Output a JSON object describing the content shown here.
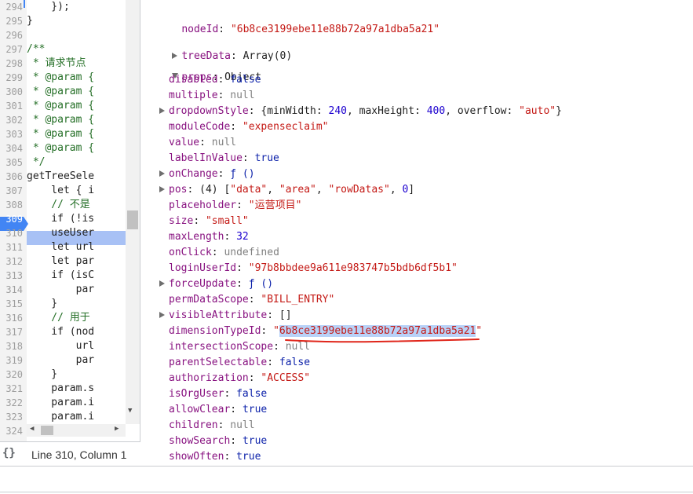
{
  "source": {
    "lines": [
      {
        "num": "294",
        "code": "    });",
        "comment": false
      },
      {
        "num": "295",
        "code": "}",
        "comment": false
      },
      {
        "num": "296",
        "code": "",
        "comment": false
      },
      {
        "num": "297",
        "code": "/**",
        "comment": true
      },
      {
        "num": "298",
        "code": " * 请求节点",
        "comment": true
      },
      {
        "num": "299",
        "code": " * @param {",
        "comment": true
      },
      {
        "num": "300",
        "code": " * @param {",
        "comment": true
      },
      {
        "num": "301",
        "code": " * @param {",
        "comment": true
      },
      {
        "num": "302",
        "code": " * @param {",
        "comment": true
      },
      {
        "num": "303",
        "code": " * @param {",
        "comment": true
      },
      {
        "num": "304",
        "code": " * @param {",
        "comment": true
      },
      {
        "num": "305",
        "code": " */",
        "comment": true
      },
      {
        "num": "306",
        "code": "getTreeSele",
        "comment": false
      },
      {
        "num": "307",
        "code": "    let { i",
        "comment": false
      },
      {
        "num": "308",
        "code": "    // 不是",
        "comment": true
      },
      {
        "num": "309",
        "code": "    if (!is",
        "comment": false
      },
      {
        "num": "310",
        "code": "    useUser",
        "comment": false
      },
      {
        "num": "311",
        "code": "    let url",
        "comment": false
      },
      {
        "num": "312",
        "code": "    let par",
        "comment": false
      },
      {
        "num": "313",
        "code": "    if (isC",
        "comment": false
      },
      {
        "num": "314",
        "code": "        par",
        "comment": false
      },
      {
        "num": "315",
        "code": "    }",
        "comment": false
      },
      {
        "num": "316",
        "code": "    // 用于",
        "comment": true
      },
      {
        "num": "317",
        "code": "    if (nod",
        "comment": false
      },
      {
        "num": "318",
        "code": "        url",
        "comment": false
      },
      {
        "num": "319",
        "code": "        par",
        "comment": false
      },
      {
        "num": "320",
        "code": "    }",
        "comment": false
      },
      {
        "num": "321",
        "code": "    param.s",
        "comment": false
      },
      {
        "num": "322",
        "code": "    param.i",
        "comment": false
      },
      {
        "num": "323",
        "code": "    param.i",
        "comment": false
      },
      {
        "num": "324",
        "code": "",
        "comment": false
      }
    ],
    "breakpoint_line": "309",
    "current_line": "310"
  },
  "status": {
    "pretty_print_icon": "{}",
    "cursor_position": "Line 310, Column 1"
  },
  "scope": {
    "node_id": {
      "key": "nodeId",
      "value": "\"6b8ce3199ebe11e88b72a97a1dba5a21\""
    },
    "tree_data": {
      "key": "treeData",
      "value": "Array(0)"
    },
    "props": {
      "key": "props",
      "value": "Object"
    },
    "props_entries": [
      {
        "key": "disabled",
        "parts": [
          {
            "t": "false",
            "c": "kw"
          }
        ],
        "expandable": false
      },
      {
        "key": "multiple",
        "parts": [
          {
            "t": "null",
            "c": "nul"
          }
        ],
        "expandable": false
      },
      {
        "key": "dropdownStyle",
        "parts": [
          {
            "t": "{minWidth: ",
            "c": "plain"
          },
          {
            "t": "240",
            "c": "num"
          },
          {
            "t": ", maxHeight: ",
            "c": "plain"
          },
          {
            "t": "400",
            "c": "num"
          },
          {
            "t": ", overflow: ",
            "c": "plain"
          },
          {
            "t": "\"auto\"",
            "c": "str"
          },
          {
            "t": "}",
            "c": "plain"
          }
        ],
        "expandable": true
      },
      {
        "key": "moduleCode",
        "parts": [
          {
            "t": "\"expenseclaim\"",
            "c": "str"
          }
        ],
        "expandable": false
      },
      {
        "key": "value",
        "parts": [
          {
            "t": "null",
            "c": "nul"
          }
        ],
        "expandable": false
      },
      {
        "key": "labelInValue",
        "parts": [
          {
            "t": "true",
            "c": "kw"
          }
        ],
        "expandable": false
      },
      {
        "key": "onChange",
        "parts": [
          {
            "t": "ƒ ()",
            "c": "kw"
          }
        ],
        "expandable": true
      },
      {
        "key": "pos",
        "parts": [
          {
            "t": "(4) [",
            "c": "plain"
          },
          {
            "t": "\"data\"",
            "c": "str"
          },
          {
            "t": ", ",
            "c": "plain"
          },
          {
            "t": "\"area\"",
            "c": "str"
          },
          {
            "t": ", ",
            "c": "plain"
          },
          {
            "t": "\"rowDatas\"",
            "c": "str"
          },
          {
            "t": ", ",
            "c": "plain"
          },
          {
            "t": "0",
            "c": "num"
          },
          {
            "t": "]",
            "c": "plain"
          }
        ],
        "expandable": true
      },
      {
        "key": "placeholder",
        "parts": [
          {
            "t": "\"运营项目\"",
            "c": "str"
          }
        ],
        "expandable": false
      },
      {
        "key": "size",
        "parts": [
          {
            "t": "\"small\"",
            "c": "str"
          }
        ],
        "expandable": false
      },
      {
        "key": "maxLength",
        "parts": [
          {
            "t": "32",
            "c": "num"
          }
        ],
        "expandable": false
      },
      {
        "key": "onClick",
        "parts": [
          {
            "t": "undefined",
            "c": "nul"
          }
        ],
        "expandable": false
      },
      {
        "key": "loginUserId",
        "parts": [
          {
            "t": "\"97b8bbdee9a611e983747b5bdb6df5b1\"",
            "c": "str"
          }
        ],
        "expandable": false
      },
      {
        "key": "forceUpdate",
        "parts": [
          {
            "t": "ƒ ()",
            "c": "kw"
          }
        ],
        "expandable": true
      },
      {
        "key": "permDataScope",
        "parts": [
          {
            "t": "\"BILL_ENTRY\"",
            "c": "str"
          }
        ],
        "expandable": false
      },
      {
        "key": "visibleAttribute",
        "parts": [
          {
            "t": "[]",
            "c": "plain"
          }
        ],
        "expandable": true
      },
      {
        "key": "dimensionTypeId",
        "parts": [
          {
            "t": "\"",
            "c": "str"
          },
          {
            "t": "6b8ce3199ebe11e88b72a97a1dba5a21",
            "c": "str sel"
          },
          {
            "t": "\"",
            "c": "str"
          }
        ],
        "expandable": false,
        "highlight": true
      },
      {
        "key": "intersectionScope",
        "parts": [
          {
            "t": "null",
            "c": "nul"
          }
        ],
        "expandable": false
      },
      {
        "key": "parentSelectable",
        "parts": [
          {
            "t": "false",
            "c": "kw"
          }
        ],
        "expandable": false
      },
      {
        "key": "authorization",
        "parts": [
          {
            "t": "\"ACCESS\"",
            "c": "str"
          }
        ],
        "expandable": false
      },
      {
        "key": "isOrgUser",
        "parts": [
          {
            "t": "false",
            "c": "kw"
          }
        ],
        "expandable": false
      },
      {
        "key": "allowClear",
        "parts": [
          {
            "t": "true",
            "c": "kw"
          }
        ],
        "expandable": false
      },
      {
        "key": "children",
        "parts": [
          {
            "t": "null",
            "c": "nul"
          }
        ],
        "expandable": false
      },
      {
        "key": "showSearch",
        "parts": [
          {
            "t": "true",
            "c": "kw"
          }
        ],
        "expandable": false
      },
      {
        "key": "showOften",
        "parts": [
          {
            "t": "true",
            "c": "kw"
          }
        ],
        "expandable": false
      }
    ]
  },
  "colors": {
    "accent_blue": "#4285f4",
    "execution_line": "#a8c1f5",
    "selection": "#b8d2f8",
    "annotation_red": "#e0261b"
  }
}
